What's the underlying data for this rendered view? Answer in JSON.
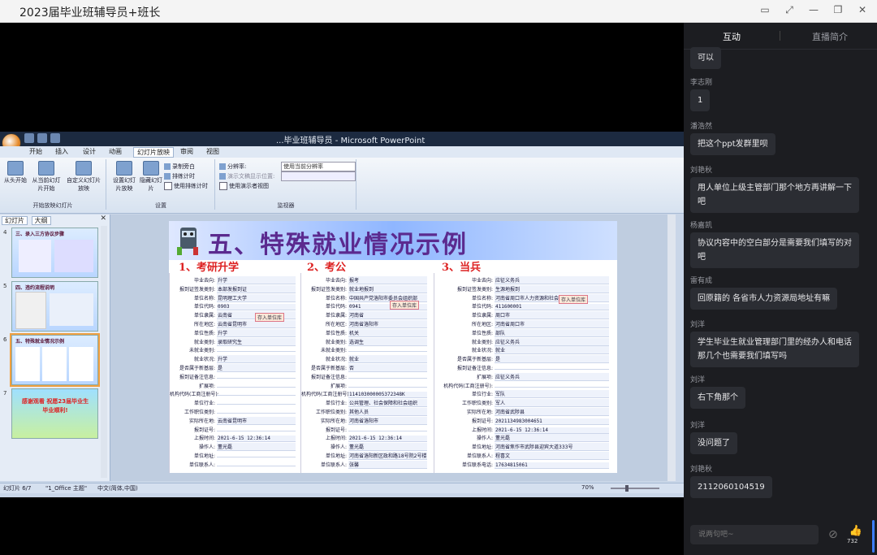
{
  "window": {
    "title": "2023届毕业班辅导员+班长"
  },
  "ppt": {
    "doc_title": "...毕业班辅导员 - Microsoft PowerPoint",
    "tabs": [
      "开始",
      "插入",
      "设计",
      "动画",
      "幻灯片放映",
      "审阅",
      "视图"
    ],
    "ribbon": {
      "from_start": "从头开始",
      "from_current": "从当前幻灯片开始",
      "custom": "自定义幻灯片放映",
      "group1": "开始放映幻灯片",
      "setup": "设置幻灯片放映",
      "hide": "隐藏幻灯片",
      "record": "录制旁白",
      "rehearse": "排练计时",
      "use_timings": "使用排练计时",
      "group2": "设置",
      "resolution": "分辨率:",
      "resolution_val": "使用当前分辨率",
      "show_on": "演示文稿显示位置:",
      "presenter": "使用演示者视图",
      "group3": "监视器"
    },
    "pane_tabs": [
      "幻灯片",
      "大纲"
    ],
    "thumb7_text": "感谢观看 祝愿23届毕业生毕业顺利!",
    "thumb4_title": "三、录入三方协议步骤",
    "thumb5_title": "四、违约流程说明",
    "thumb6_title": "五、特殊就业情况示例",
    "status": {
      "slide": "幻灯片 6/7",
      "theme": "\"1_Office 主题\"",
      "lang": "中文(简体,中国)",
      "zoom": "70%"
    }
  },
  "slide": {
    "title": "五、特殊就业情况示例",
    "sub1": "1、考研升学",
    "sub2": "2、考公",
    "sub3": "3、当兵",
    "col1": [
      [
        "毕业去向:",
        "升学"
      ],
      [
        "报到证签发类别:",
        "本部发报到证"
      ],
      [
        "单位名称:",
        "昆明理工大学"
      ],
      [
        "单位代码:",
        "0903"
      ],
      [
        "单位隶属:",
        "云南省"
      ],
      [
        "所在地区:",
        "云南省昆明市"
      ],
      [
        "单位性质:",
        "升学"
      ],
      [
        "就业类别:",
        "录取研究生"
      ],
      [
        "未就业类别:",
        ""
      ],
      [
        "就业状况:",
        "升学"
      ],
      [
        "是否属于新基层:",
        "是"
      ],
      [
        "报到证备注信息:",
        ""
      ],
      [
        "扩展项:",
        ""
      ],
      [
        "机构代码(工商注册号):",
        ""
      ],
      [
        "单位行业:",
        ""
      ],
      [
        "工作职位类别:",
        ""
      ],
      [
        "实际所在地:",
        "云南省昆明市"
      ],
      [
        "报到证号:",
        ""
      ],
      [
        "上报时间:",
        "2021-6-15 12:36:14"
      ],
      [
        "操作人:",
        "董光磊"
      ],
      [
        "单位地址:",
        ""
      ],
      [
        "单位联系人:",
        ""
      ]
    ],
    "col2": [
      [
        "毕业去向:",
        "报考"
      ],
      [
        "报到证签发类别:",
        "就业地报到"
      ],
      [
        "单位名称:",
        "中国共产党洛阳市委员会组织部"
      ],
      [
        "单位代码:",
        "0941"
      ],
      [
        "单位隶属:",
        "河南省"
      ],
      [
        "所在地区:",
        "河南省洛阳市"
      ],
      [
        "单位性质:",
        "机关"
      ],
      [
        "就业类别:",
        "选调生"
      ],
      [
        "未就业类别:",
        ""
      ],
      [
        "就业状况:",
        "就业"
      ],
      [
        "是否属于新基层:",
        "否"
      ],
      [
        "报到证备注信息:",
        ""
      ],
      [
        "扩展项:",
        ""
      ],
      [
        "机构代码(工商注册号):",
        "114103000005372348K"
      ],
      [
        "单位行业:",
        "公共管理、社会保障和社会组织"
      ],
      [
        "工作职位类别:",
        "其他人员"
      ],
      [
        "实际所在地:",
        "河南省洛阳市"
      ],
      [
        "报到证号:",
        ""
      ],
      [
        "上报时间:",
        "2021-6-15 12:36:14"
      ],
      [
        "操作人:",
        "董光磊"
      ],
      [
        "单位地址:",
        "河南省洛阳新区政和路18号院2号楼"
      ],
      [
        "单位联系人:",
        "张馨"
      ]
    ],
    "col3": [
      [
        "毕业去向:",
        "应征义务兵"
      ],
      [
        "报到证签发类别:",
        "生源地报到"
      ],
      [
        "单位名称:",
        "河南省周口市人力资源和社会保障"
      ],
      [
        "单位代码:",
        "411600001"
      ],
      [
        "单位隶属:",
        "周口市"
      ],
      [
        "所在地区:",
        "河南省周口市"
      ],
      [
        "单位性质:",
        "部队"
      ],
      [
        "就业类别:",
        "应征义务兵"
      ],
      [
        "就业状况:",
        "就业"
      ],
      [
        "是否属于新基层:",
        "是"
      ],
      [
        "报到证备注信息:",
        ""
      ],
      [
        "扩展项:",
        "应征义务兵"
      ],
      [
        "机构代码(工商注册号):",
        ""
      ],
      [
        "单位行业:",
        "军队"
      ],
      [
        "工作职位类别:",
        "军人"
      ],
      [
        "实际所在地:",
        "河南省武陟县"
      ],
      [
        "报到证号:",
        "2021134983004651"
      ],
      [
        "上报时间:",
        "2021-6-15 12:36:14"
      ],
      [
        "操作人:",
        "董光磊"
      ],
      [
        "单位地址:",
        "河南省焦作市武陟县迎宾大道333号"
      ],
      [
        "单位联系人:",
        "程喜文"
      ],
      [
        "单位联系电话:",
        "17634815061"
      ]
    ],
    "save_btn": "存入单位库"
  },
  "chat": {
    "tabs": [
      "互动",
      "直播简介"
    ],
    "messages": [
      {
        "name": "",
        "text": "可以"
      },
      {
        "name": "李志刚",
        "text": "1"
      },
      {
        "name": "潘浩然",
        "text": "把这个ppt发群里呗"
      },
      {
        "name": "刘艳秋",
        "text": "用人单位上级主管部门那个地方再讲解一下吧"
      },
      {
        "name": "杨嘉凯",
        "text": "协议内容中的空白部分是需要我们填写的对吧"
      },
      {
        "name": "雷有成",
        "text": "回原籍的 各省市人力资源局地址有嘛"
      },
      {
        "name": "刘洋",
        "text": "学生毕业生就业管理部门里的经办人和电话那几个也需要我们填写吗"
      },
      {
        "name": "刘洋",
        "text": "右下角那个"
      },
      {
        "name": "刘洋",
        "text": "没问题了"
      },
      {
        "name": "刘艳秋",
        "text": "2112060104519"
      }
    ],
    "input_placeholder": "说两句吧~",
    "like_count": "732"
  },
  "colors": {
    "accent": "#3d7eff",
    "panel": "#1c1d21",
    "bubble": "#2b2d33"
  }
}
